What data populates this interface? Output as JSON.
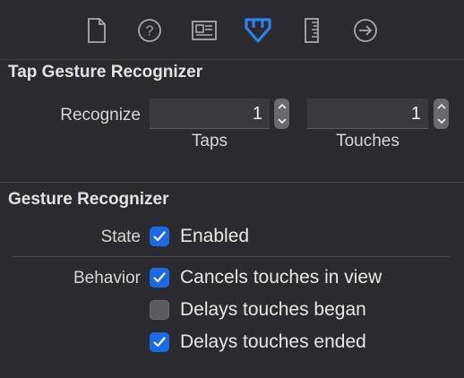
{
  "tabs": [
    {
      "icon": "file-inspector-icon"
    },
    {
      "icon": "help-inspector-icon"
    },
    {
      "icon": "identity-inspector-icon"
    },
    {
      "icon": "attributes-inspector-icon",
      "selected": true
    },
    {
      "icon": "size-inspector-icon"
    },
    {
      "icon": "connections-inspector-icon"
    }
  ],
  "tap_section": {
    "title": "Tap Gesture Recognizer",
    "recognize_label": "Recognize",
    "taps_value": "1",
    "taps_label": "Taps",
    "touches_value": "1",
    "touches_label": "Touches"
  },
  "gesture_section": {
    "title": "Gesture Recognizer",
    "state_label": "State",
    "enabled_label": "Enabled",
    "enabled_checked": true,
    "behavior_label": "Behavior",
    "behaviors": [
      {
        "label": "Cancels touches in view",
        "checked": true
      },
      {
        "label": "Delays touches began",
        "checked": false
      },
      {
        "label": "Delays touches ended",
        "checked": true
      }
    ]
  },
  "colors": {
    "background": "#2b2b2d",
    "accent": "#1a6ae6",
    "selected_tab": "#2f7ff5"
  }
}
